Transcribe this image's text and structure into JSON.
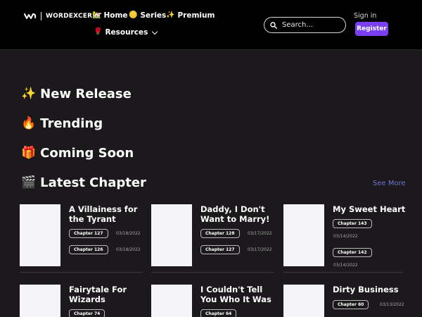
{
  "header": {
    "logo_text": "WORDEXCERPT",
    "nav": {
      "home": {
        "icon": "🏡",
        "label": "Home"
      },
      "series": {
        "icon": "🪙",
        "label": "Series"
      },
      "premium": {
        "icon": "✨",
        "label": "Premium"
      },
      "resources": {
        "icon": "🌹",
        "label": "Resources"
      }
    },
    "search_placeholder": "Search...",
    "signin_label": "Sign in",
    "register_label": "Register"
  },
  "sections": {
    "new_release": {
      "icon": "✨",
      "title": "New Release"
    },
    "trending": {
      "icon": "🔥",
      "title": "Trending"
    },
    "coming_soon": {
      "icon": "🎁",
      "title": "Coming Soon"
    },
    "latest": {
      "icon": "🎬",
      "title": "Latest Chapter",
      "see_more": "See More"
    }
  },
  "latest_cards": [
    {
      "title": "A Villainess for the Tyrant",
      "chapters": [
        {
          "label": "Chapter 127",
          "date": "03/18/2022"
        },
        {
          "label": "Chapter 126",
          "date": "03/18/2022"
        }
      ]
    },
    {
      "title": "Daddy, I Don't Want to Marry!",
      "chapters": [
        {
          "label": "Chapter 128",
          "date": "03/17/2022"
        },
        {
          "label": "Chapter 127",
          "date": "03/17/2022"
        }
      ]
    },
    {
      "title": "My Sweet Heart",
      "chapters": [
        {
          "label": "Chapter 143",
          "date": "03/14/2022"
        },
        {
          "label": "Chapter 142",
          "date": "03/14/2022"
        }
      ]
    },
    {
      "title": "Fairytale For Wizards",
      "chapters": [
        {
          "label": "Chapter 74",
          "date": ""
        }
      ]
    },
    {
      "title": "I Couldn't Tell You Who It Was",
      "chapters": [
        {
          "label": "Chapter 64",
          "date": ""
        }
      ]
    },
    {
      "title": "Dirty Business",
      "chapters": [
        {
          "label": "Chapter 60",
          "date": "03/13/2022"
        }
      ]
    }
  ]
}
